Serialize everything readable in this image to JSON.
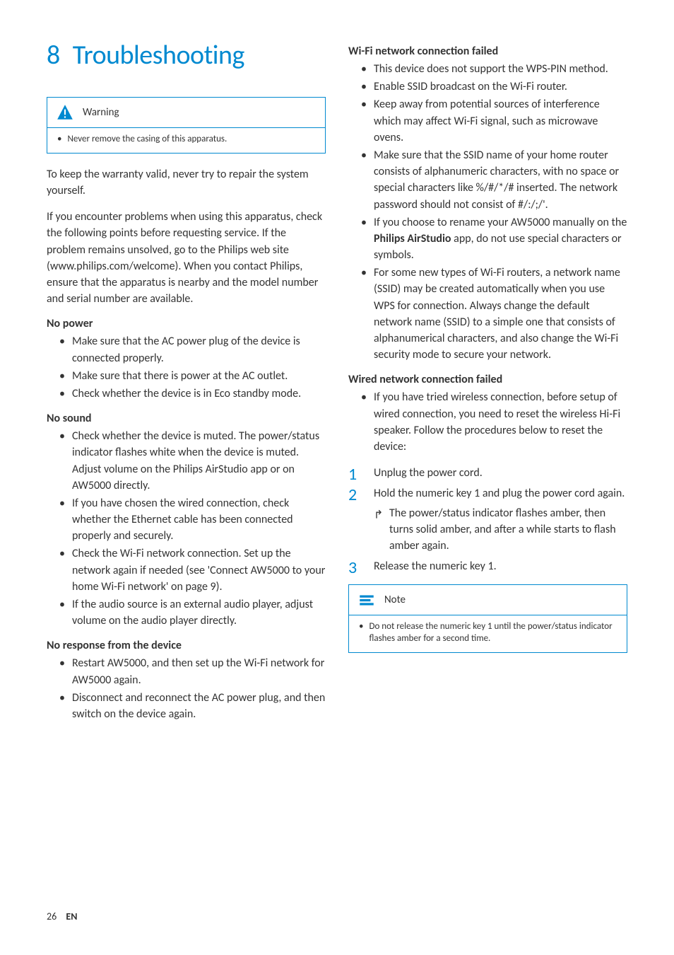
{
  "title_number": "8",
  "title_text": "Troubleshooting",
  "warning": {
    "label": "Warning",
    "text": "Never remove the casing of this apparatus."
  },
  "intro_p1": "To keep the warranty valid, never try to repair the system yourself.",
  "intro_p2": "If you encounter problems when using this apparatus, check the following points before requesting service. If the problem remains unsolved, go to the Philips web site (www.philips.com/welcome). When you contact Philips, ensure that the apparatus is nearby and the model number and serial number are available.",
  "sections": {
    "no_power": {
      "heading": "No power",
      "items": [
        "Make sure that the AC power plug of the device is connected properly.",
        "Make sure that there is power at the AC outlet.",
        "Check whether the device is in Eco standby mode."
      ]
    },
    "no_sound": {
      "heading": "No sound",
      "items": [
        "Check whether the device is muted. The power/status indicator flashes white when the device is muted. Adjust volume on the Philips AirStudio app or on AW5000 directly.",
        "If you have chosen the wired connection, check whether the Ethernet cable has been connected properly and securely.",
        "Check the Wi-Fi network connection. Set up the network again if needed (see 'Connect AW5000 to your home Wi-Fi network' on page 9).",
        "If the audio source is an external audio player, adjust volume on the audio player directly."
      ]
    },
    "no_response": {
      "heading": "No response from the device",
      "items": [
        "Restart AW5000, and then set up the Wi-Fi network for AW5000 again.",
        "Disconnect and reconnect the AC power plug, and then switch on the device again."
      ]
    },
    "wifi_failed": {
      "heading": "Wi-Fi network connection failed",
      "items": [
        "This device does not support the WPS-PIN method.",
        "Enable SSID broadcast on the Wi-Fi router.",
        "Keep away from potential sources of interference which may affect Wi-Fi signal, such as microwave ovens.",
        "Make sure that the SSID name of your home router consists of alphanumeric characters, with no space or special characters like %/#/*/# inserted. The network password should not consist of #/:/;/'."
      ],
      "item_airstudio_pre": "If you choose to rename your AW5000 manually on the ",
      "item_airstudio_bold": "Philips AirStudio",
      "item_airstudio_post": " app, do not use special characters or symbols.",
      "item_wps": "For some new types of Wi-Fi routers, a network name (SSID) may be created automatically when you use WPS for connection. Always change the default network name (SSID) to a simple one that consists of alphanumerical characters, and also change the Wi-Fi security mode to secure your network."
    },
    "wired_failed": {
      "heading": "Wired network connection failed",
      "intro": "If you have tried wireless connection, before setup of wired connection, you need to reset the wireless Hi-Fi speaker. Follow the procedures below to reset the device:",
      "steps": {
        "s1": "Unplug the power cord.",
        "s2": "Hold the numeric key 1 and plug the power cord again.",
        "s2_result": "The power/status indicator flashes amber, then turns solid amber, and after a while starts to flash amber again.",
        "s3": "Release the numeric key 1."
      }
    }
  },
  "note": {
    "label": "Note",
    "text": "Do not release the numeric key 1 until the power/status indicator flashes amber for a second time."
  },
  "footer": {
    "page": "26",
    "lang": "EN"
  }
}
